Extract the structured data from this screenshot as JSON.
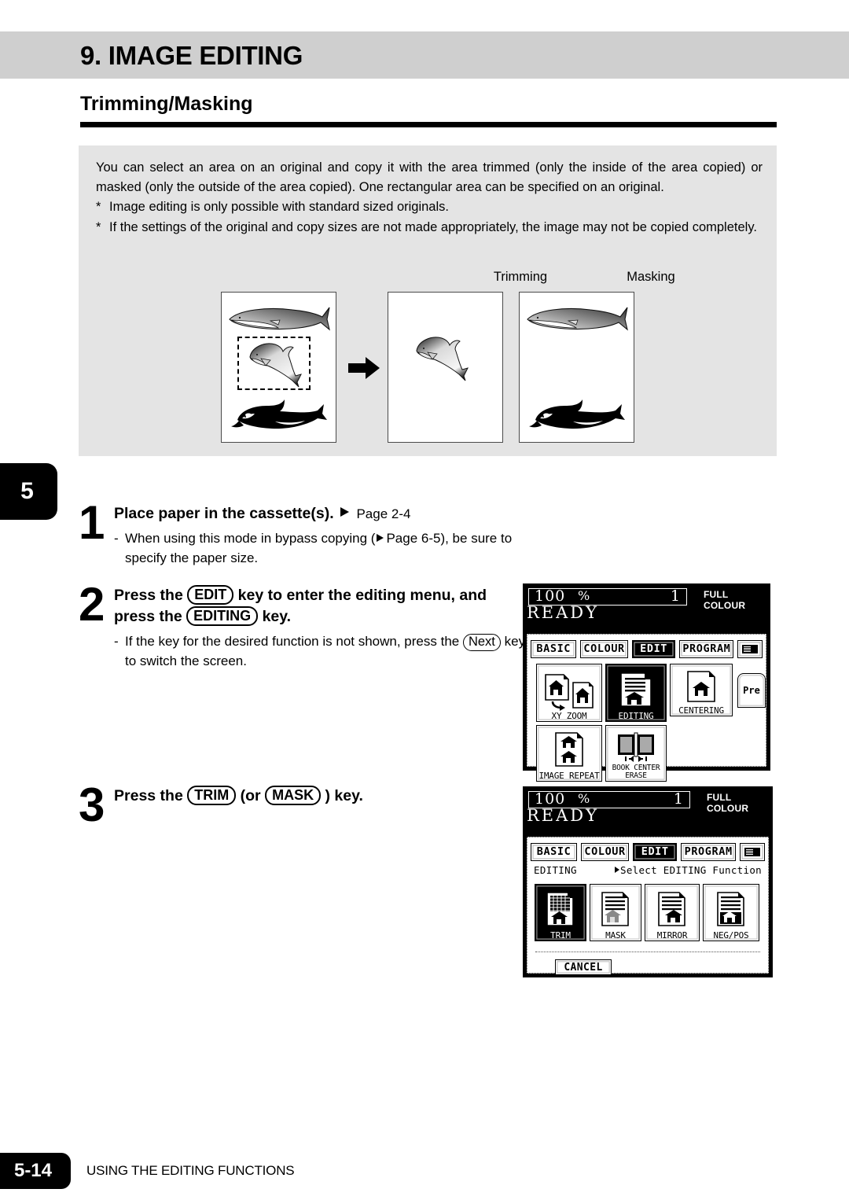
{
  "chapter": {
    "title": "9. IMAGE EDITING"
  },
  "section": {
    "title": "Trimming/Masking"
  },
  "description": {
    "paragraph": "You can select an area on an original and copy it with the area trimmed (only the inside of the area copied) or masked (only the outside of the area copied). One rectangular area can be specified on an original.",
    "notes": [
      {
        "marker": "*",
        "text": "Image editing is only possible with standard sized originals."
      },
      {
        "marker": "*",
        "text": "If the settings of the original and copy sizes are not made appropriately, the image may not be copied completely."
      }
    ]
  },
  "illustration": {
    "label_trimming": "Trimming",
    "label_masking": "Masking"
  },
  "side_tab": {
    "chapter_number": "5"
  },
  "steps": [
    {
      "number": "1",
      "head_pre": "Place paper in the cassette(s).",
      "head_ref": "Page 2-4",
      "sub_dash": "-",
      "sub_a": "When using this mode in bypass copying (",
      "sub_ref": "Page 6-5",
      "sub_b": "), be sure to specify the paper size."
    },
    {
      "number": "2",
      "head_a": "Press the",
      "head_key1": "EDIT",
      "head_b": "key to enter the editing menu, and press the",
      "head_key2": "EDITING",
      "head_c": "key.",
      "sub_dash": "-",
      "sub_a": "If the key for the desired function is not shown, press the",
      "sub_key": "Next",
      "sub_b": "key to switch the screen."
    },
    {
      "number": "3",
      "head_a": "Press the",
      "head_key1": "TRIM",
      "head_b": "(or",
      "head_key2": "MASK",
      "head_c": ") key."
    }
  ],
  "lcd_panel_1": {
    "ratio": "100",
    "percent": "%",
    "copy_count": "1",
    "colour_mode": "FULL COLOUR",
    "status": "READY",
    "tabs": [
      {
        "label": "BASIC",
        "selected": false
      },
      {
        "label": "COLOUR",
        "selected": false
      },
      {
        "label": "EDIT",
        "selected": true
      },
      {
        "label": "PROGRAM",
        "selected": false
      }
    ],
    "keyboard_tab_icon": "keypad-icon",
    "functions": [
      {
        "label": "XY ZOOM",
        "selected": false
      },
      {
        "label": "EDITING",
        "selected": true
      },
      {
        "label": "CENTERING",
        "selected": false
      },
      {
        "label": "IMAGE REPEAT",
        "selected": false
      },
      {
        "label_line1": "BOOK CENTER",
        "label_line2": "ERASE",
        "selected": false
      }
    ],
    "preview_tab_label": "Pre"
  },
  "lcd_panel_2": {
    "ratio": "100",
    "percent": "%",
    "copy_count": "1",
    "colour_mode": "FULL COLOUR",
    "status": "READY",
    "tabs": [
      {
        "label": "BASIC",
        "selected": false
      },
      {
        "label": "COLOUR",
        "selected": false
      },
      {
        "label": "EDIT",
        "selected": true
      },
      {
        "label": "PROGRAM",
        "selected": false
      }
    ],
    "keyboard_tab_icon": "keypad-icon",
    "mode_label": "EDITING",
    "prompt": "Select EDITING Function",
    "functions": [
      {
        "label": "TRIM",
        "selected": true
      },
      {
        "label": "MASK",
        "selected": false
      },
      {
        "label": "MIRROR",
        "selected": false
      },
      {
        "label": "NEG/POS",
        "selected": false
      }
    ],
    "cancel_label": "CANCEL"
  },
  "footer": {
    "page_number": "5-14",
    "section_name": "USING THE EDITING FUNCTIONS"
  },
  "colors": {
    "chapter_bar": "#cfcfcf",
    "desc_panel": "#e4e4e4",
    "ink": "#000000"
  }
}
